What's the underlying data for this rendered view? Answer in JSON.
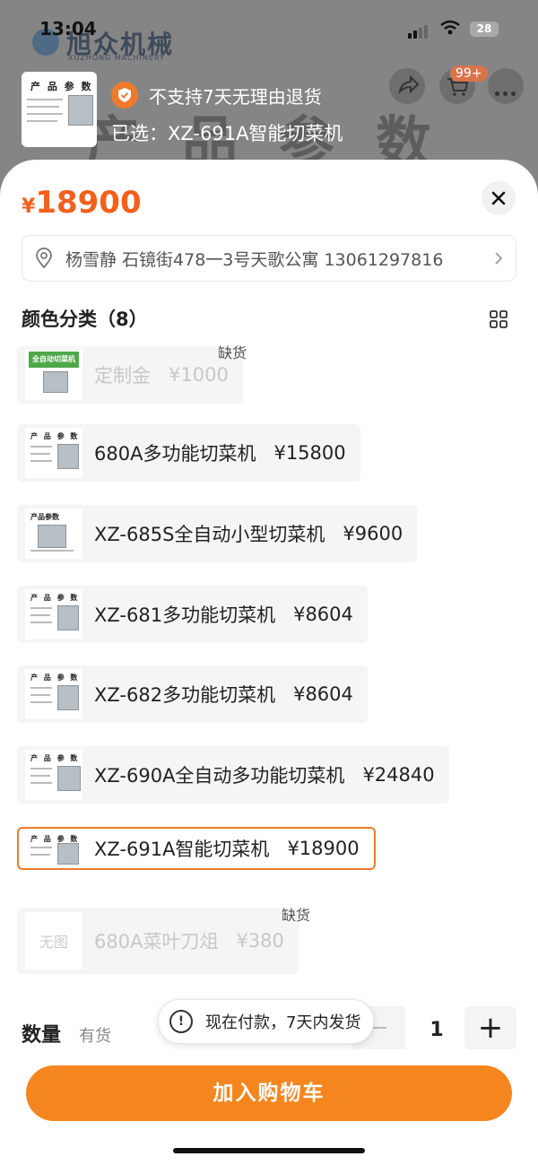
{
  "status_bar": {
    "time": "13:04",
    "battery": "28"
  },
  "background": {
    "brand_cn": "旭众机械",
    "brand_en": "XUZHONG MACHINERY",
    "banner_title": "产品参数",
    "cart_badge": "99+"
  },
  "header": {
    "return_policy": "不支持7天无理由退货",
    "selected_text": "已选：XZ-691A智能切菜机",
    "thumb_caption": "产 品 参 数"
  },
  "sheet": {
    "price_currency": "¥",
    "price_value": "18900",
    "address": "杨雪静 石镜街478一3号天歌公寓 13061297816",
    "section_title": "颜色分类（8）"
  },
  "options": [
    {
      "label": "定制金",
      "price": "¥1000",
      "stock_tag": "缺货",
      "thumb_caption": "全自动切菜机"
    },
    {
      "label": "680A多功能切菜机",
      "price": "¥15800",
      "thumb_caption": "产 品 参 数"
    },
    {
      "label": "XZ-685S全自动小型切菜机",
      "price": "¥9600",
      "thumb_caption": "产品参数"
    },
    {
      "label": "XZ-681多功能切菜机",
      "price": "¥8604",
      "thumb_caption": "产 品 参 数"
    },
    {
      "label": "XZ-682多功能切菜机",
      "price": "¥8604",
      "thumb_caption": "产 品 参 数"
    },
    {
      "label": "XZ-690A全自动多功能切菜机",
      "price": "¥24840",
      "thumb_caption": "产 品 参 数"
    },
    {
      "label": "XZ-691A智能切菜机",
      "price": "¥18900",
      "thumb_caption": "产 品 参 数"
    },
    {
      "label": "680A菜叶刀俎",
      "price": "¥380",
      "stock_tag": "缺货",
      "no_image": "无图"
    }
  ],
  "quantity": {
    "label": "数量",
    "stock": "有货",
    "value": "1",
    "plus": "+"
  },
  "toast": {
    "text": "现在付款，7天内发货"
  },
  "actions": {
    "add_to_cart": "加入购物车"
  },
  "colors": {
    "accent": "#f07a2b",
    "price": "#f2601e",
    "button": "#f5861f"
  },
  "icons": [
    "shield-check-icon",
    "close-icon",
    "location-pin-icon",
    "chevron-right-icon",
    "grid-view-icon",
    "info-icon",
    "share-icon",
    "cart-icon",
    "more-icon"
  ]
}
